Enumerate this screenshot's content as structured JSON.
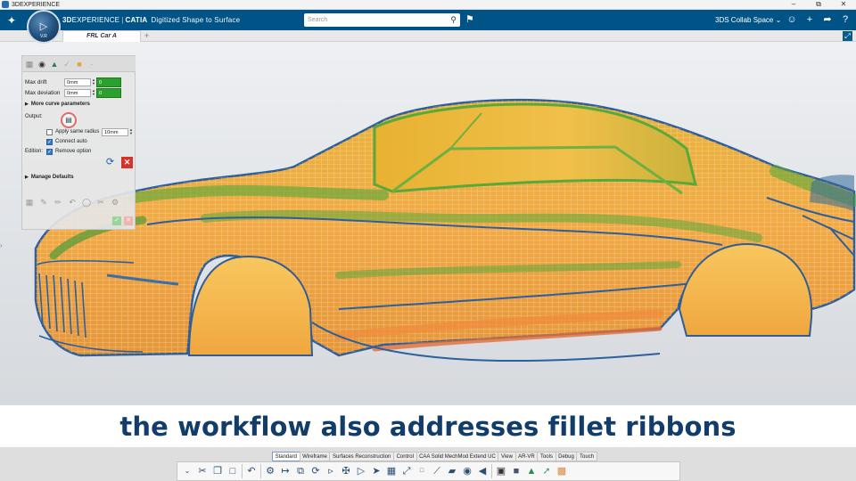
{
  "os_title": "3DEXPERIENCE",
  "header": {
    "brand_3d": "3D",
    "brand_experience": "EXPERIENCE",
    "brand_app": "CATIA",
    "workbench": "Digitized Shape to Surface",
    "search_placeholder": "Search",
    "collab_space": "3DS Collab Space",
    "compass_version": "V.R"
  },
  "tabs": [
    {
      "label": "FRL Car A"
    }
  ],
  "panel": {
    "max_drift_label": "Max drift",
    "max_drift_value": "0mm",
    "max_drift_result": "0",
    "max_deviation_label": "Max deviation",
    "max_deviation_value": "0mm",
    "max_deviation_result": "0",
    "more_params": "More curve parameters",
    "output_label": "Output:",
    "apply_radius_label": "Apply same radius",
    "apply_radius_value": "10mm",
    "apply_radius_checked": false,
    "connect_auto_label": "Connect auto",
    "connect_auto_checked": true,
    "edition_label": "Edition:",
    "remove_option_label": "Remove option",
    "remove_option_checked": true,
    "manage_defaults": "Manage Defaults"
  },
  "caption": "the workflow also addresses fillet ribbons",
  "action_tabs": [
    {
      "label": "Standard",
      "active": true
    },
    {
      "label": "Wireframe",
      "active": false
    },
    {
      "label": "Surfaces Reconstruction",
      "active": false
    },
    {
      "label": "Control",
      "active": false
    },
    {
      "label": "CAA Solid MechMod Extend UC",
      "active": false
    },
    {
      "label": "View",
      "active": false
    },
    {
      "label": "AR-VR",
      "active": false
    },
    {
      "label": "Tools",
      "active": false
    },
    {
      "label": "Debug",
      "active": false
    },
    {
      "label": "Touch",
      "active": false
    }
  ],
  "colors": {
    "header_bg": "#005386",
    "caption_text": "#123d6a",
    "mesh_orange": "#f5b13a",
    "mesh_green": "#5aa83a",
    "mesh_blue": "#2b5f9e",
    "ok_green": "#2ca02c",
    "cancel_red": "#d8312a"
  }
}
